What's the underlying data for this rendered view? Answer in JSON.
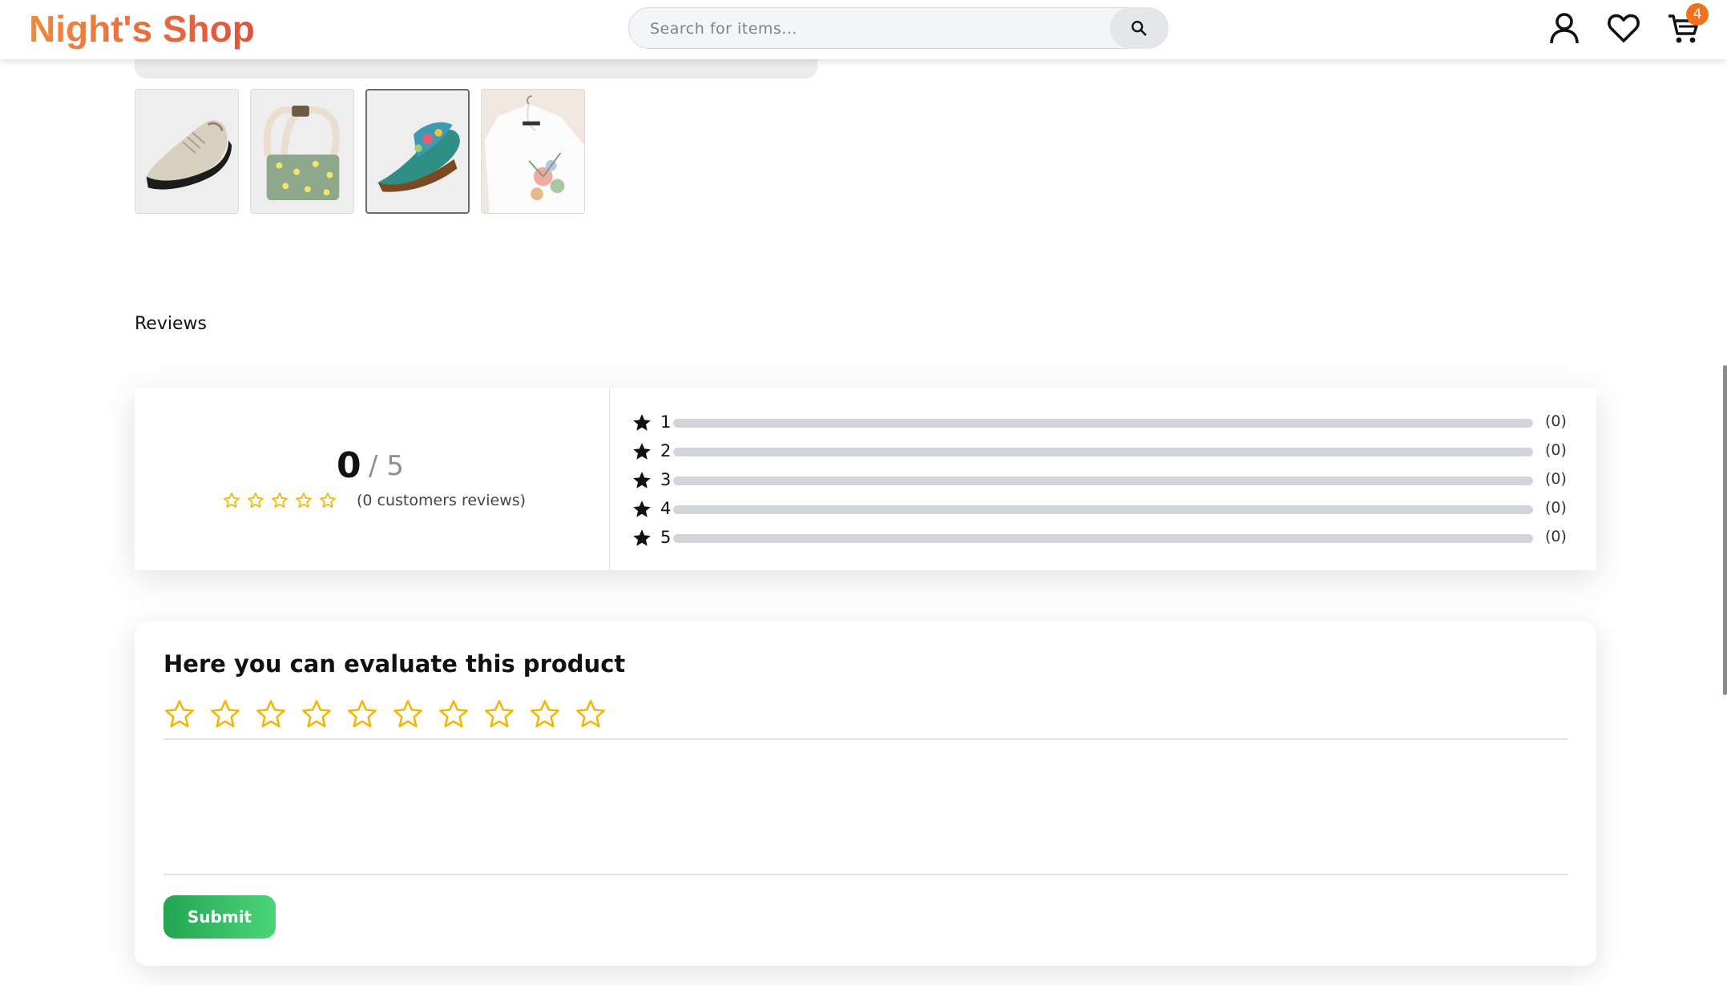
{
  "header": {
    "logo": "Night's Shop",
    "search_placeholder": "Search for items...",
    "cart_count": "4"
  },
  "gallery": {
    "thumbnails": [
      {
        "alt": "shoe-thumbnail",
        "active": false
      },
      {
        "alt": "handbag-thumbnail",
        "active": false
      },
      {
        "alt": "sandal-thumbnail",
        "active": true
      },
      {
        "alt": "blouse-thumbnail",
        "active": false
      }
    ]
  },
  "reviews": {
    "title": "Reviews",
    "score": "0",
    "score_of": "/ 5",
    "average_stars": 0,
    "customers_text": "(0 customers reviews)",
    "rows": [
      {
        "stars": "1",
        "count": "(0)",
        "fraction": 0
      },
      {
        "stars": "2",
        "count": "(0)",
        "fraction": 0
      },
      {
        "stars": "3",
        "count": "(0)",
        "fraction": 0
      },
      {
        "stars": "4",
        "count": "(0)",
        "fraction": 0
      },
      {
        "stars": "5",
        "count": "(0)",
        "fraction": 0
      }
    ]
  },
  "evaluate": {
    "title": "Here you can evaluate this product",
    "star_count": 10,
    "selected": 0,
    "comment": "",
    "submit_label": "Submit"
  },
  "colors": {
    "star_outline": "#f5b400",
    "bar_track": "#d1d5db",
    "badge": "#f2711c",
    "submit_start": "#22a652",
    "submit_end": "#4cd47a"
  }
}
